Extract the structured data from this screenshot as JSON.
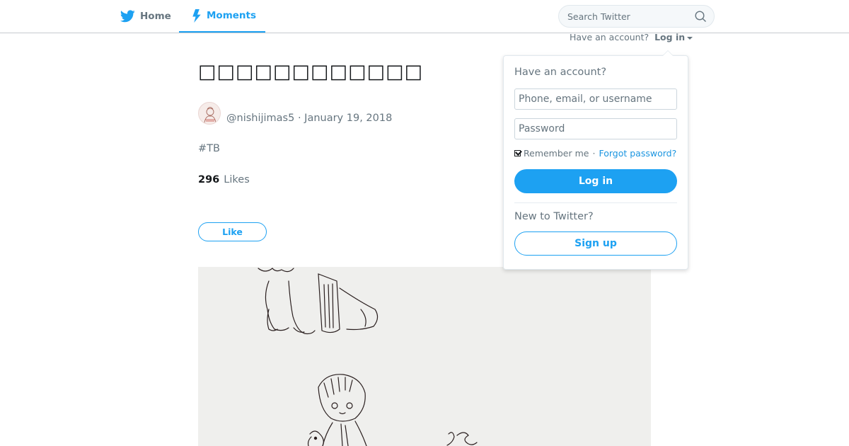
{
  "nav": {
    "home_label": "Home",
    "home_icon": "twitter-bird-icon",
    "moments_label": "Moments",
    "moments_icon": "lightning-bolt-icon",
    "accent_color": "#1da1f2"
  },
  "search": {
    "placeholder": "Search Twitter",
    "icon": "search-icon"
  },
  "account": {
    "prompt": "Have an account?",
    "login_label": "Log in"
  },
  "moment": {
    "title": "□□□□□□□□□□□□",
    "handle": "@nishijimas5",
    "separator": "·",
    "date": "January 19, 2018",
    "hashtag": "#TB",
    "like_count": "296",
    "likes_label": "Likes",
    "like_button": "Like"
  },
  "login_dropdown": {
    "heading": "Have an account?",
    "username_placeholder": "Phone, email, or username",
    "password_placeholder": "Password",
    "remember_label": "Remember me",
    "remember_checked": true,
    "separator": "·",
    "forgot_label": "Forgot password?",
    "login_button": "Log in",
    "new_heading": "New to Twitter?",
    "signup_button": "Sign up"
  }
}
